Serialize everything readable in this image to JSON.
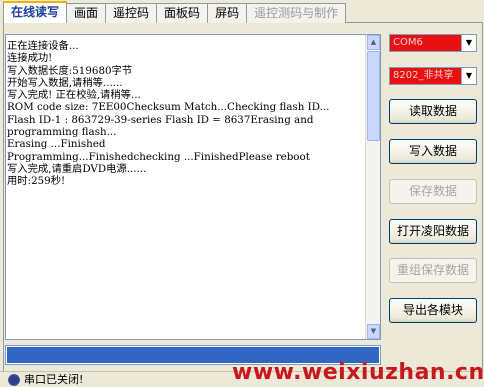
{
  "tabs": [
    {
      "label": "在线读写",
      "active": true
    },
    {
      "label": "画面"
    },
    {
      "label": "遥控码"
    },
    {
      "label": "面板码"
    },
    {
      "label": "屏码"
    },
    {
      "label": "遥控测码与制作",
      "disabled": true
    }
  ],
  "log": {
    "lines": [
      "正在连接设备...",
      "连接成功!",
      "写入数据长度:519680字节",
      "开始写入数据,请稍等......",
      "写入完成! 正在校验,请稍等...",
      "ROM code size: 7EE00Checksum Match...Checking flash ID...",
      "Flash ID-1 : 863729-39-series Flash ID = 8637Erasing and",
      "programming flash...",
      "Erasing ...Finished",
      "Programming...Finishedchecking ...FinishedPlease reboot",
      "写入完成,请重启DVD电源......",
      "用时:259秒!"
    ]
  },
  "controls": {
    "port_select": "COM6",
    "mode_select": "8202_非共享",
    "read_button": "读取数据",
    "write_button": "写入数据",
    "save_button": "保存数据",
    "open_button": "打开凌阳数据",
    "regroup_save_button": "重组保存数据",
    "export_button": "导出各模块"
  },
  "progress": {
    "value": 1.0
  },
  "status": {
    "text": "串口已关闭!"
  },
  "watermark": "www.weixiuzhan.cn",
  "colors": {
    "select_bg": "#e81010",
    "progress_fill": "#3166c5",
    "watermark": "#c8181e"
  }
}
